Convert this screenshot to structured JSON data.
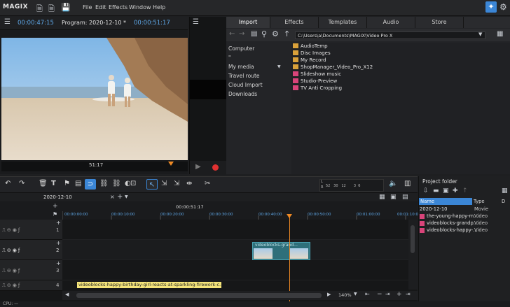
{
  "app": {
    "logo": "MAGIX"
  },
  "menu": [
    "File",
    "Edit",
    "Effects",
    "Window",
    "Help"
  ],
  "program_monitor": {
    "position_time": "00:00:47:15",
    "title": "Program: 2020-12-10 *",
    "duration_time": "00:00:51:17",
    "scrub_time": "51:17"
  },
  "transport": {
    "buttons": [
      "[",
      "]",
      "|←",
      "■",
      "▶",
      "[→]",
      "→|"
    ]
  },
  "browser": {
    "tabs": [
      "Import",
      "Effects",
      "Templates",
      "Audio",
      "Store"
    ],
    "active_tab": "Import",
    "path": "C:\\Users\\a\\Documents\\MAGIX\\Video Pro X",
    "tree": [
      "Computer",
      "\"",
      "My media",
      "Travel route",
      "Cloud Import",
      "Downloads"
    ],
    "files": [
      {
        "name": "AudioTemp",
        "kind": "folder"
      },
      {
        "name": "Disc Images",
        "kind": "folder"
      },
      {
        "name": "My Record",
        "kind": "folder"
      },
      {
        "name": "ShopManager_Video_Pro_X12",
        "kind": "folder"
      },
      {
        "name": "Slideshow music",
        "kind": "special"
      },
      {
        "name": "Studio-Preview",
        "kind": "special"
      },
      {
        "name": "TV Anti Cropping",
        "kind": "special"
      }
    ]
  },
  "timeline": {
    "tab_label": "2020-12-10",
    "total_time": "00:00:51:17",
    "ruler_ticks": [
      "00:00:00:00",
      "00:00:10:00",
      "00:00:20:00",
      "00:00:30:00",
      "00:00:40:00",
      "00:00:50:00",
      "00:01:00:00",
      "00:01:10:00"
    ],
    "tracks": [
      "1",
      "2",
      "3",
      "4"
    ],
    "clip_label": "videoblocks-grand...",
    "text_clip": "videoblocks-happy-birthday-girl-reacts-at-sparkling-firework-c...",
    "zoom": "140%",
    "meter_scale": [
      "52",
      "30",
      "12",
      "3",
      "6",
      "L",
      "R"
    ]
  },
  "project_folder": {
    "title": "Project folder",
    "columns": [
      "Name",
      "Type",
      "D"
    ],
    "rows": [
      {
        "name": "2020-12-10",
        "type": "Movie"
      },
      {
        "name": "the-young-happy-m...",
        "type": "Video"
      },
      {
        "name": "videoblocks-grandp...",
        "type": "Video"
      },
      {
        "name": "videoblocks-happy-...",
        "type": "Video"
      }
    ]
  },
  "status": {
    "cpu": "CPU: —"
  },
  "colors": {
    "accent": "#3b86d6",
    "timecode": "#5fa8e8",
    "playhead": "#f08a24",
    "clip": "#2e6f7a",
    "text_clip": "#f4e47a",
    "folder": "#d9a13a",
    "special_file": "#d9447a"
  }
}
